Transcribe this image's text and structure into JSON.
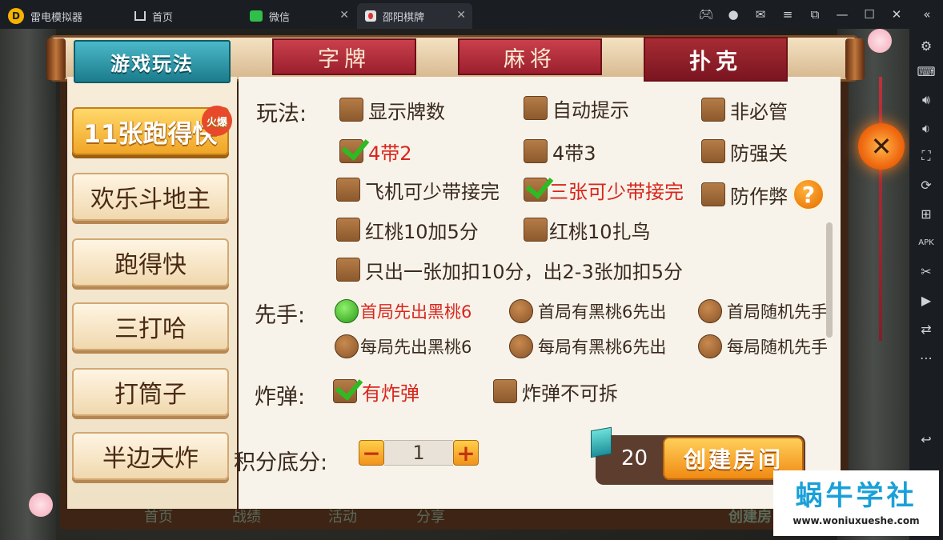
{
  "titlebar": {
    "app_name": "雷电模拟器",
    "tabs": [
      {
        "label": "首页",
        "icon": "home-icon"
      },
      {
        "label": "微信",
        "icon": "wechat-icon"
      },
      {
        "label": "邵阳棋牌",
        "icon": "game-icon",
        "active": true
      }
    ]
  },
  "game": {
    "title": "游戏玩法",
    "top_tabs": [
      "字牌",
      "麻将",
      "扑克"
    ],
    "active_top_tab": "扑克",
    "modes": [
      "11张跑得快",
      "欢乐斗地主",
      "跑得快",
      "三打哈",
      "打筒子",
      "半边天炸"
    ],
    "hot_badge": "火爆",
    "labels": {
      "wanfa": "玩法:",
      "xianshou": "先手:",
      "zhadan": "炸弹:",
      "score": "积分底分:"
    },
    "wanfa_options": [
      {
        "label": "显示牌数",
        "checked": false
      },
      {
        "label": "自动提示",
        "checked": false
      },
      {
        "label": "非必管",
        "checked": false
      },
      {
        "label": "4带2",
        "checked": true
      },
      {
        "label": "4带3",
        "checked": false
      },
      {
        "label": "防强关",
        "checked": false
      },
      {
        "label": "飞机可少带接完",
        "checked": false
      },
      {
        "label": "三张可少带接完",
        "checked": true
      },
      {
        "label": "防作弊",
        "checked": false
      },
      {
        "label": "红桃10加5分",
        "checked": false
      },
      {
        "label": "红桃10扎鸟",
        "checked": false
      },
      {
        "label": "只出一张加扣10分，出2-3张加扣5分",
        "checked": false
      }
    ],
    "xianshou_options": [
      {
        "label": "首局先出黑桃6",
        "selected": true
      },
      {
        "label": "首局有黑桃6先出",
        "selected": false
      },
      {
        "label": "首局随机先手",
        "selected": false
      },
      {
        "label": "每局先出黑桃6",
        "selected": false
      },
      {
        "label": "每局有黑桃6先出",
        "selected": false
      },
      {
        "label": "每局随机先手",
        "selected": false
      }
    ],
    "zhadan_options": [
      {
        "label": "有炸弹",
        "checked": true
      },
      {
        "label": "炸弹不可拆",
        "checked": false
      }
    ],
    "score_value": "1",
    "minus": "−",
    "plus": "+",
    "help": "?",
    "gem_count": "20",
    "create_button": "创建房间",
    "close": "✕",
    "bottom_bar": [
      "首页",
      "战绩",
      "活动",
      "分享"
    ],
    "bottom_right": "创建房"
  },
  "watermark": {
    "title": "蜗牛学社",
    "url": "www.woniuxueshe.com"
  },
  "colors": {
    "selected_text": "#d8261d",
    "check_green": "#2fba23",
    "accent_orange": "#f08b13",
    "teal": "#1b7c8c"
  }
}
